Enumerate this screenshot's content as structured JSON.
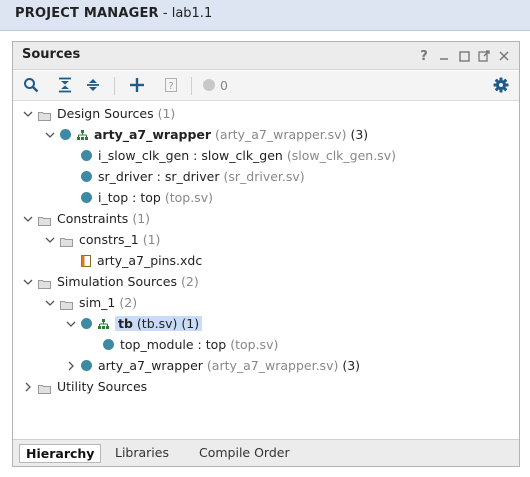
{
  "header": {
    "title": "PROJECT MANAGER",
    "subtitle": " - lab1.1"
  },
  "panel": {
    "title": "Sources",
    "help": "?"
  },
  "toolbar": {
    "message_count": "0"
  },
  "tree": {
    "design_sources": {
      "label": "Design Sources",
      "count": "(1)"
    },
    "arty_wrapper": {
      "name": "arty_a7_wrapper",
      "file": "(arty_a7_wrapper.sv)",
      "count": "(3)"
    },
    "slow_clk": {
      "name": "i_slow_clk_gen : slow_clk_gen",
      "file": "(slow_clk_gen.sv)"
    },
    "sr_driver": {
      "name": "sr_driver : sr_driver",
      "file": "(sr_driver.sv)"
    },
    "i_top": {
      "name": "i_top : top",
      "file": "(top.sv)"
    },
    "constraints": {
      "label": "Constraints",
      "count": "(1)"
    },
    "constrs_1": {
      "label": "constrs_1",
      "count": "(1)"
    },
    "xdc": {
      "name": "arty_a7_pins.xdc"
    },
    "sim_sources": {
      "label": "Simulation Sources",
      "count": "(2)"
    },
    "sim_1": {
      "label": "sim_1",
      "count": "(2)"
    },
    "tb": {
      "name": "tb",
      "file": "(tb.sv)",
      "count": "(1)"
    },
    "top_module": {
      "name": "top_module : top",
      "file": "(top.sv)"
    },
    "arty_wrapper_sim": {
      "name": "arty_a7_wrapper",
      "file": "(arty_a7_wrapper.sv)",
      "count": "(3)"
    },
    "utility": {
      "label": "Utility Sources"
    }
  },
  "tabs": [
    "Hierarchy",
    "Libraries",
    "Compile Order"
  ],
  "colors": {
    "header_bg": "#dde5f3",
    "module_dot": "#3e8aa5",
    "selected_bg": "#c9dbf6",
    "toolbar_icon": "#1f5c8a"
  }
}
